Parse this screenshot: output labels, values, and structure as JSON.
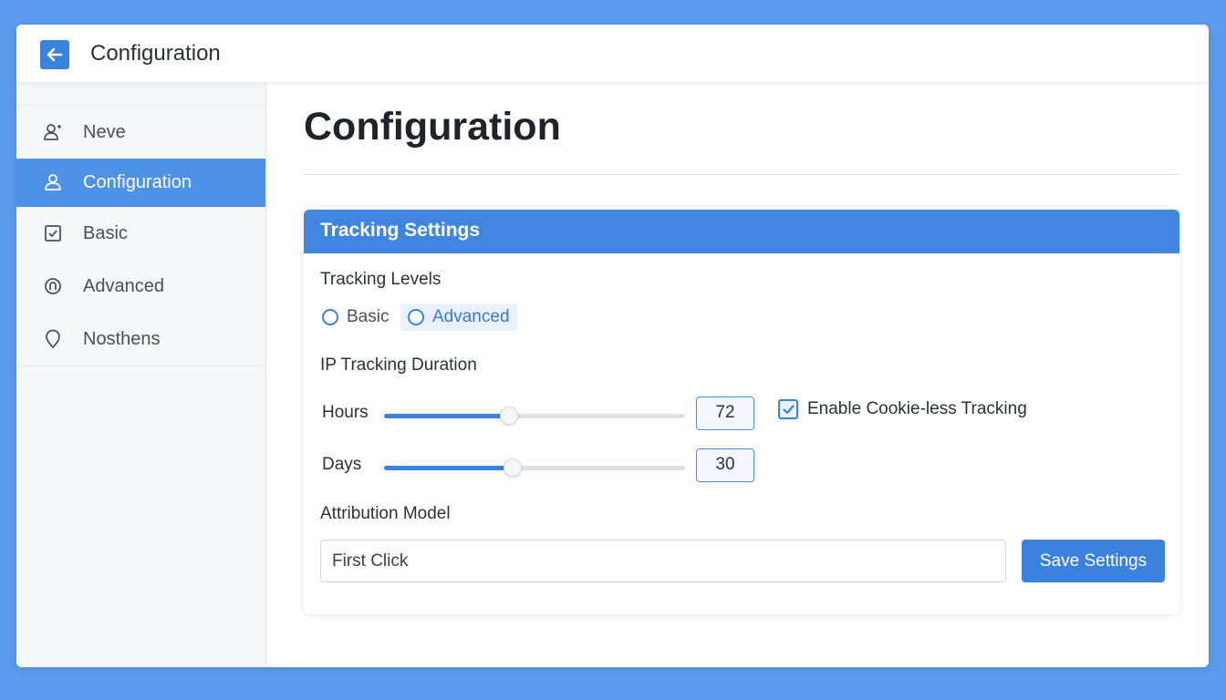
{
  "window": {
    "title": "Configuration"
  },
  "sidebar": {
    "items": [
      {
        "label": "Neve",
        "icon": "user-add-icon",
        "active": false
      },
      {
        "label": "Configuration",
        "icon": "user-icon",
        "active": true
      },
      {
        "label": "Basic",
        "icon": "checkbox-icon",
        "active": false
      },
      {
        "label": "Advanced",
        "icon": "at-icon",
        "active": false
      },
      {
        "label": "Nosthens",
        "icon": "location-pin-icon",
        "active": false
      }
    ]
  },
  "main": {
    "page_title": "Configuration",
    "card": {
      "header": "Tracking Settings",
      "tracking_levels_label": "Tracking Levels",
      "tracking_levels": [
        {
          "label": "Basic",
          "selected": false
        },
        {
          "label": "Advanced",
          "selected": false
        }
      ],
      "ip_duration_label": "IP Tracking Duration",
      "hours": {
        "label": "Hours",
        "value": "72",
        "slider_fraction": 0.41
      },
      "days": {
        "label": "Days",
        "value": "30",
        "slider_fraction": 0.42
      },
      "cookieless": {
        "label": "Enable Cookie-less Tracking",
        "checked": true
      },
      "attribution_label": "Attribution Model",
      "attribution_value": "First Click",
      "save_label": "Save Settings"
    }
  },
  "colors": {
    "accent": "#3a82de",
    "background": "#5b9cee",
    "sidebar_active": "#4d92e6"
  }
}
